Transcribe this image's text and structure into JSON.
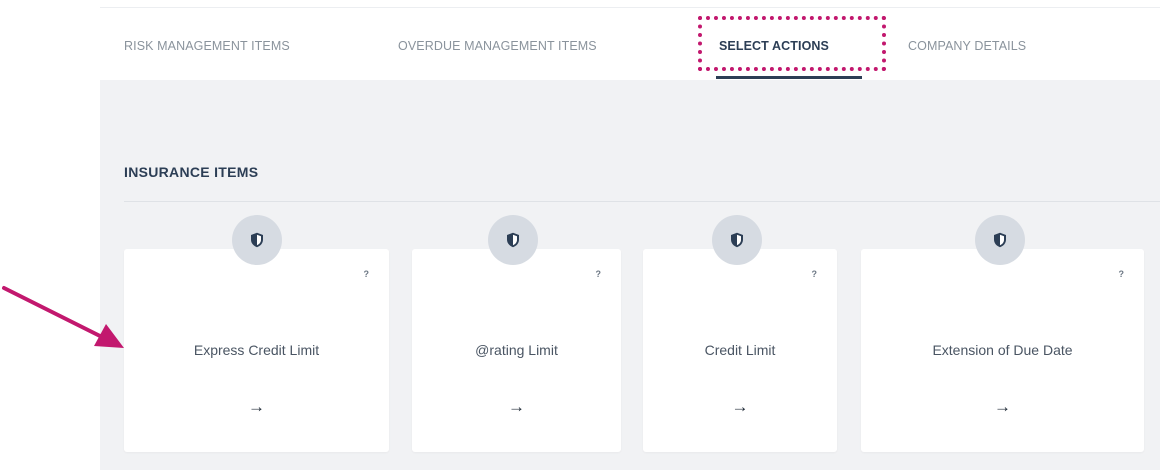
{
  "tabs": [
    {
      "label": "RISK MANAGEMENT ITEMS",
      "active": false
    },
    {
      "label": "OVERDUE MANAGEMENT ITEMS",
      "active": false
    },
    {
      "label": "SELECT ACTIONS",
      "active": true
    },
    {
      "label": "COMPANY DETAILS",
      "active": false
    }
  ],
  "section": {
    "title": "INSURANCE ITEMS"
  },
  "cards": [
    {
      "label": "Express Credit Limit",
      "icon": "shield-icon",
      "help": "?",
      "arrow": "→"
    },
    {
      "label": "@rating Limit",
      "icon": "shield-icon",
      "help": "?",
      "arrow": "→"
    },
    {
      "label": "Credit Limit",
      "icon": "shield-icon",
      "help": "?",
      "arrow": "→"
    },
    {
      "label": "Extension of Due Date",
      "icon": "shield-icon",
      "help": "?",
      "arrow": "→"
    }
  ],
  "colors": {
    "annotation": "#c2186e",
    "active_tab": "#2c3e55",
    "background": "#f1f2f4",
    "icon_circle": "#d6dbe2"
  }
}
